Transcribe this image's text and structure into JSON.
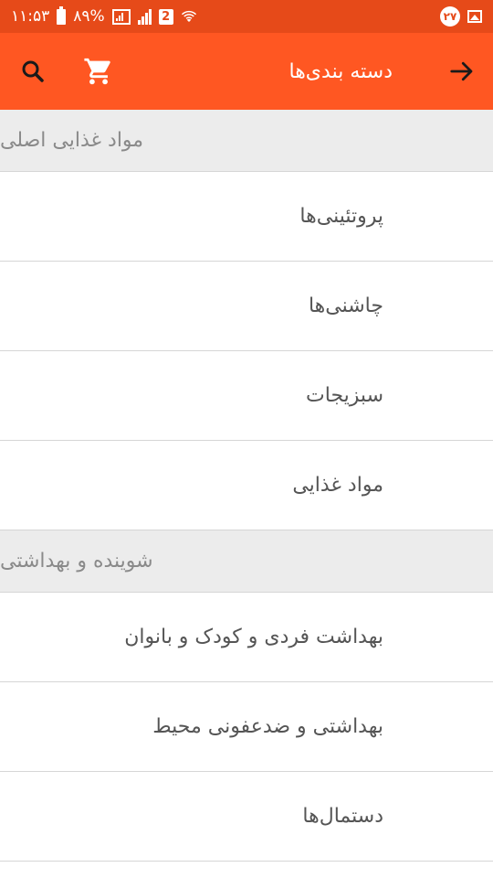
{
  "status_bar": {
    "time": "۱۱:۵۳",
    "battery": "۸۹%",
    "sim2_label": "2",
    "notification_count": "۲۷"
  },
  "app_bar": {
    "title": "دسته بندی‌ها",
    "back_icon": "arrow-forward-icon",
    "cart_icon": "shopping-cart-icon",
    "search_icon": "search-icon"
  },
  "sections": [
    {
      "header": "مواد غذایی اصلی",
      "items": [
        "پروتئینی‌ها",
        "چاشنی‌ها",
        "سبزیجات",
        "مواد غذایی"
      ]
    },
    {
      "header": "شوینده و بهداشتی",
      "items": [
        "بهداشت فردی و کودک و بانوان",
        "بهداشتی و ضدعفونی محیط",
        "دستمال‌ها"
      ]
    }
  ],
  "colors": {
    "status_bar": "#e64a19",
    "app_bar": "#ff5722",
    "section_bg": "#ececec",
    "divider": "#d6d6d6"
  }
}
